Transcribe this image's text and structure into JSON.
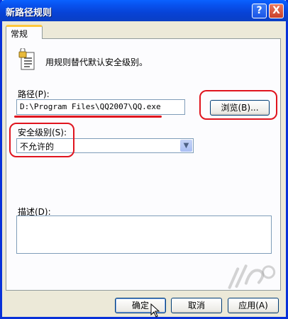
{
  "window": {
    "title": "新路径规则",
    "help_glyph": "?",
    "close_glyph": "X"
  },
  "tabs": [
    {
      "label": "常规",
      "active": true
    }
  ],
  "general": {
    "icon": "lock-document-icon",
    "description_text": "用规则替代默认安全级别。",
    "path_label": "路径(P):",
    "path_value": "D:\\Program Files\\QQ2007\\QQ.exe",
    "browse_label": "浏览(B)...",
    "security_level_label": "安全级别(S):",
    "security_level_value": "不允许的",
    "description_label": "描述(D):",
    "description_value": ""
  },
  "buttons": {
    "ok": "确定",
    "cancel": "取消",
    "apply": "应用(A)"
  },
  "colors": {
    "title_blue": "#0a3fc4",
    "annotation_red": "#e0141e",
    "dialog_bg": "#ece9d8"
  },
  "watermark_icon": "site-watermark-logo"
}
